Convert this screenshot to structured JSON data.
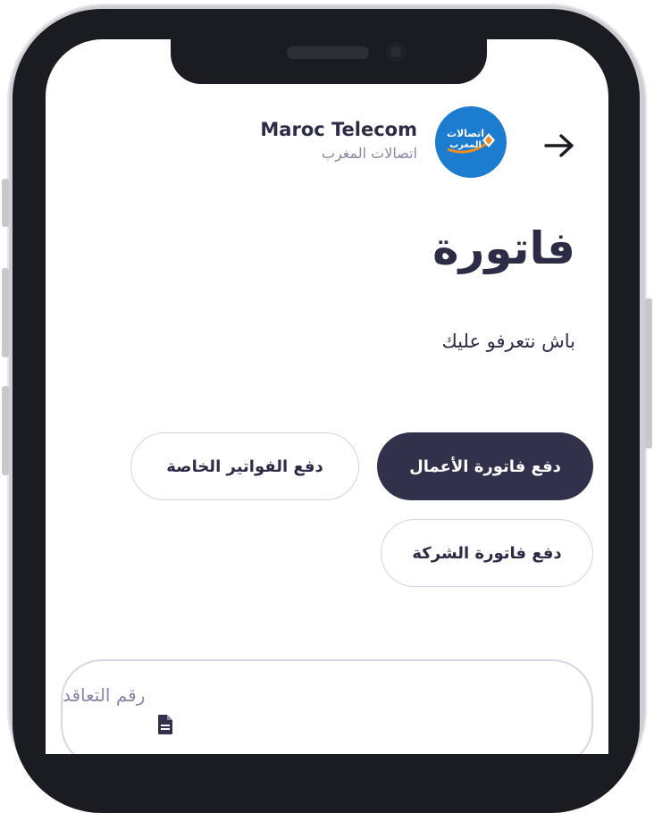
{
  "header": {
    "brand_name": "Maroc Telecom",
    "brand_subtitle": "اتصالات المغرب",
    "logo_text_line1": "اتصالات",
    "logo_text_line2": "المغرب",
    "back_icon": "arrow-right-icon"
  },
  "page": {
    "title": "فاتورة",
    "subtitle": "باش نتعرفو عليك"
  },
  "options": [
    {
      "label": "دفع فاتورة الأعمال",
      "selected": true
    },
    {
      "label": "دفع الفواتير الخاصة",
      "selected": false
    },
    {
      "label": "دفع فاتورة الشركة",
      "selected": false
    }
  ],
  "contract_field": {
    "placeholder": "رقم التعاقد",
    "icon": "document-icon"
  },
  "colors": {
    "primary_dark": "#32314b",
    "text_dark": "#2d2c47",
    "text_muted": "#8a87a6",
    "border": "#d5d3e2",
    "brand_blue": "#1c7ccf",
    "brand_orange": "#f28c1e"
  }
}
